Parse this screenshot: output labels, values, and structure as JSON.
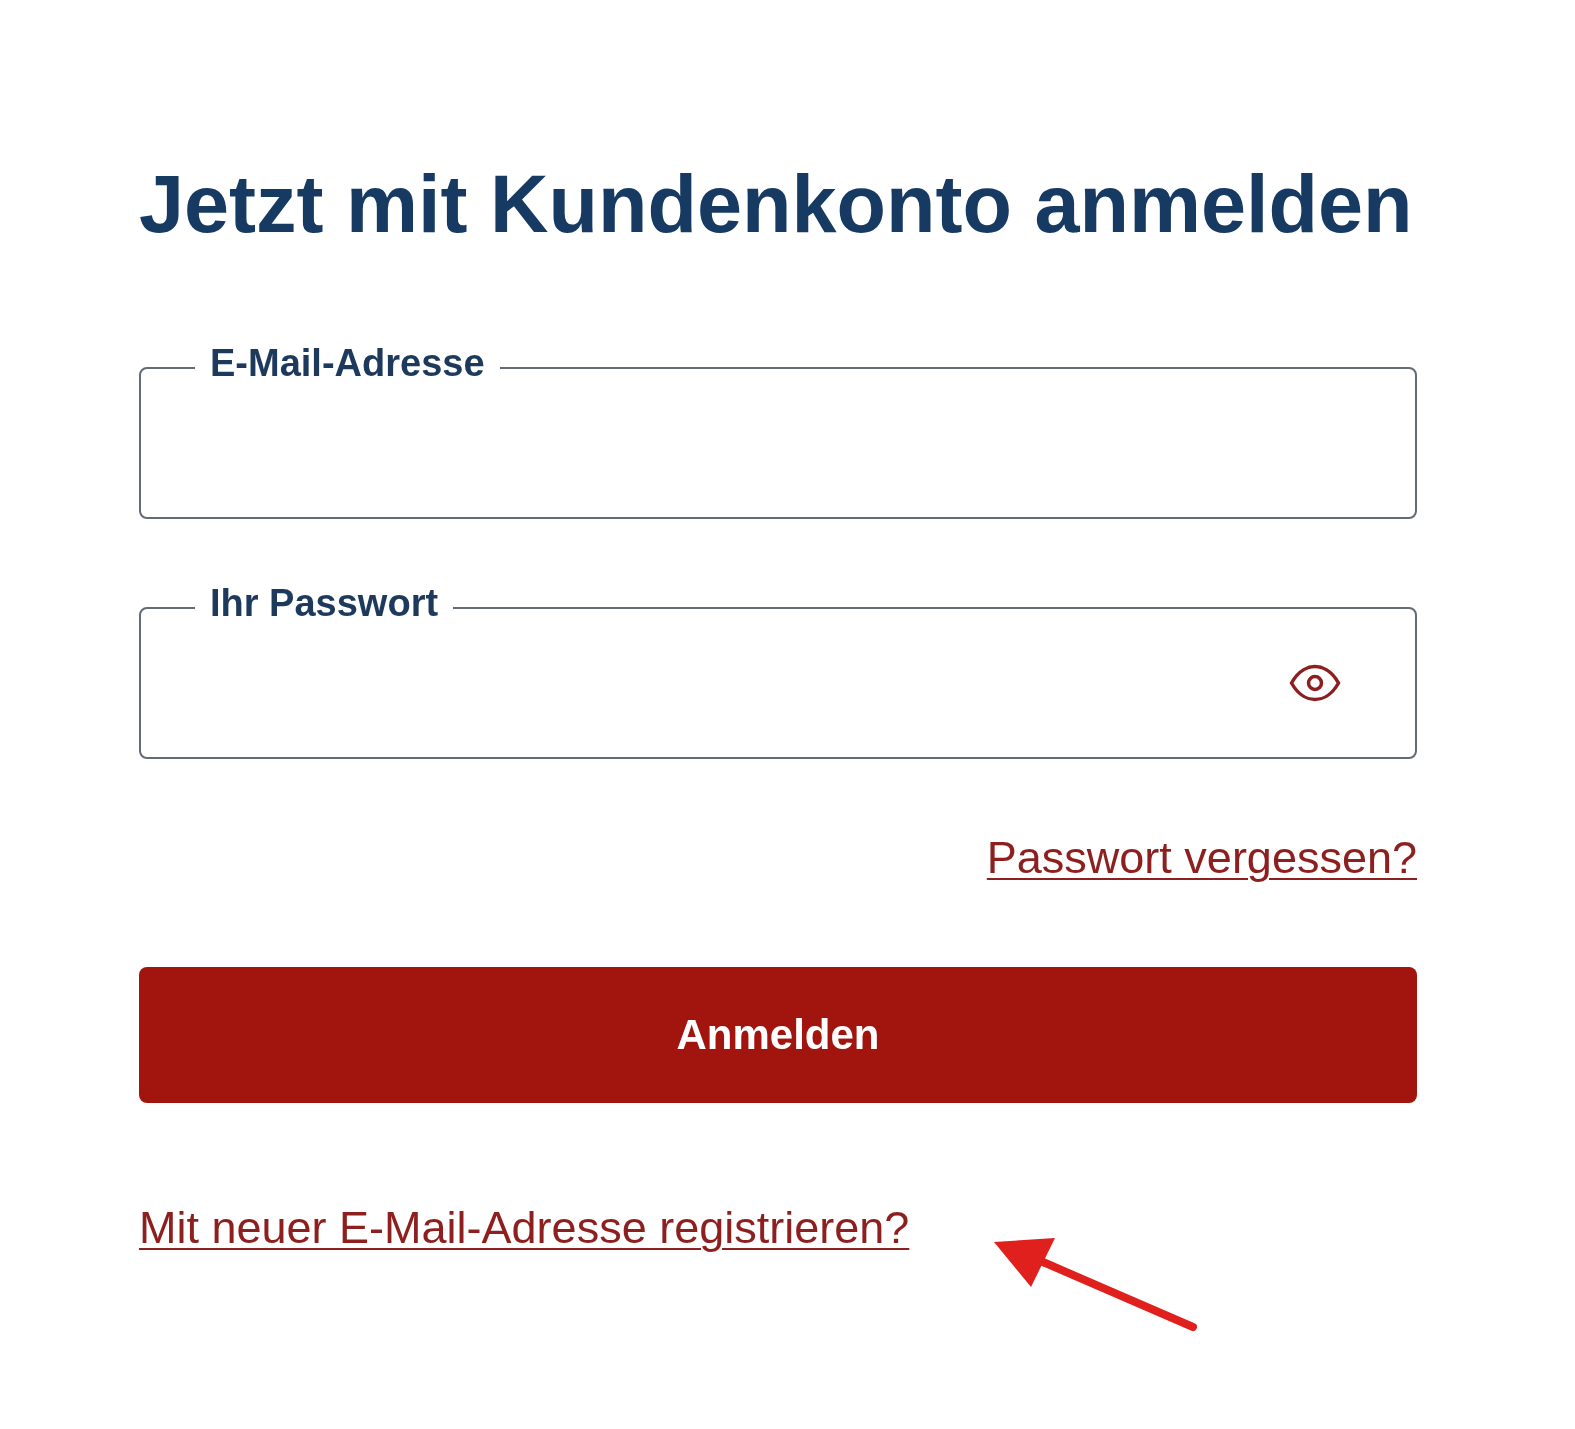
{
  "heading": "Jetzt mit Kundenkonto anmelden",
  "fields": [
    {
      "kind": "email",
      "label": "E-Mail-Adresse"
    },
    {
      "kind": "password",
      "label": "Ihr Passwort"
    }
  ],
  "forgot_link": "Passwort vergessen?",
  "submit_button": "Anmelden",
  "register_link": "Mit neuer E-Mail-Adresse registrieren?"
}
